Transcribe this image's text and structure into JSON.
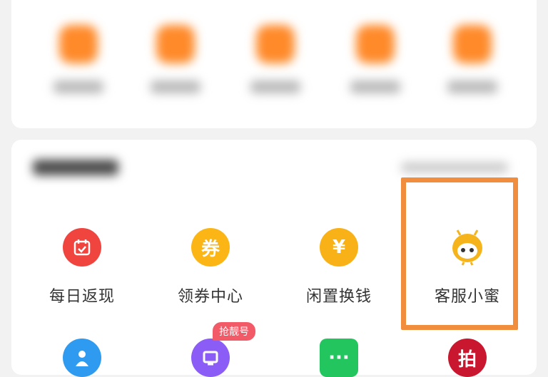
{
  "top_section": {
    "items": [
      {
        "icon": "orange-shortcut-icon",
        "label": ""
      },
      {
        "icon": "orange-shortcut-icon",
        "label": ""
      },
      {
        "icon": "orange-shortcut-icon",
        "label": ""
      },
      {
        "icon": "orange-shortcut-icon",
        "label": ""
      },
      {
        "icon": "orange-shortcut-icon",
        "label": ""
      }
    ]
  },
  "tools_section": {
    "title": "",
    "more": "",
    "row1": [
      {
        "label": "每日返现",
        "icon": "calendar-check-icon",
        "color": "#f0443e"
      },
      {
        "label": "领券中心",
        "icon": "coupon-icon",
        "color": "#fbb515",
        "glyph": "券"
      },
      {
        "label": "闲置换钱",
        "icon": "yen-coin-icon",
        "color": "#f9b118",
        "glyph": "¥"
      },
      {
        "label": "客服小蜜",
        "icon": "bee-mascot-icon",
        "color": "#f6b41c"
      }
    ],
    "row2": [
      {
        "icon": "blue-person-icon",
        "color": "#2f9bf0"
      },
      {
        "icon": "purple-number-icon",
        "color": "#8b5cf6",
        "badge": "抢靓号"
      },
      {
        "icon": "green-chat-icon",
        "color": "#22c55e",
        "glyph": "···"
      },
      {
        "icon": "auction-icon",
        "color": "#c8172e",
        "glyph": "拍"
      }
    ]
  },
  "colors": {
    "accent": "#f08e3d",
    "background": "#f2f2f2"
  }
}
